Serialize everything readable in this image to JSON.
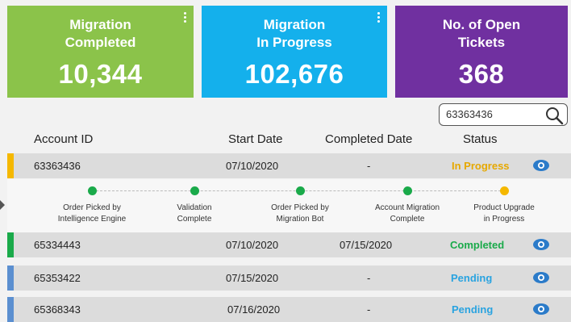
{
  "cards": [
    {
      "title": "Migration\nCompleted",
      "value": "10,344",
      "color": "#8bc34a",
      "has_menu": true
    },
    {
      "title": "Migration\nIn Progress",
      "value": "102,676",
      "color": "#14b0ec",
      "has_menu": true
    },
    {
      "title": "No. of Open\nTickets",
      "value": "368",
      "color": "#7030a0",
      "has_menu": false
    }
  ],
  "search": {
    "value": "63363436",
    "icon": "magnifier-icon"
  },
  "table": {
    "headers": {
      "account_id": "Account ID",
      "start_date": "Start Date",
      "completed_date": "Completed Date",
      "status": "Status"
    },
    "rows": [
      {
        "account_id": "63363436",
        "start_date": "07/10/2020",
        "completed_date": "-",
        "status": "In Progress",
        "status_color": "#e6a800",
        "bar_color": "#f5b800"
      },
      {
        "account_id": "65334443",
        "start_date": "07/10/2020",
        "completed_date": "07/15/2020",
        "status": "Completed",
        "status_color": "#1aaa4a",
        "bar_color": "#1aaa4a"
      },
      {
        "account_id": "65353422",
        "start_date": "07/15/2020",
        "completed_date": "-",
        "status": "Pending",
        "status_color": "#29a3e0",
        "bar_color": "#5b8fd0"
      },
      {
        "account_id": "65368343",
        "start_date": "07/16/2020",
        "completed_date": "-",
        "status": "Pending",
        "status_color": "#29a3e0",
        "bar_color": "#5b8fd0"
      }
    ]
  },
  "timeline": {
    "steps": [
      {
        "label": "Order Picked by\nIntelligence Engine",
        "color": "#1aaa4a"
      },
      {
        "label": "Validation\nComplete",
        "color": "#1aaa4a"
      },
      {
        "label": "Order Picked by\nMigration Bot",
        "color": "#1aaa4a"
      },
      {
        "label": "Account Migration\nComplete",
        "color": "#1aaa4a"
      },
      {
        "label": "Product Upgrade\nin Progress",
        "color": "#f5b800"
      }
    ]
  },
  "colors": {
    "eye_icon": "#2b7bc9"
  }
}
